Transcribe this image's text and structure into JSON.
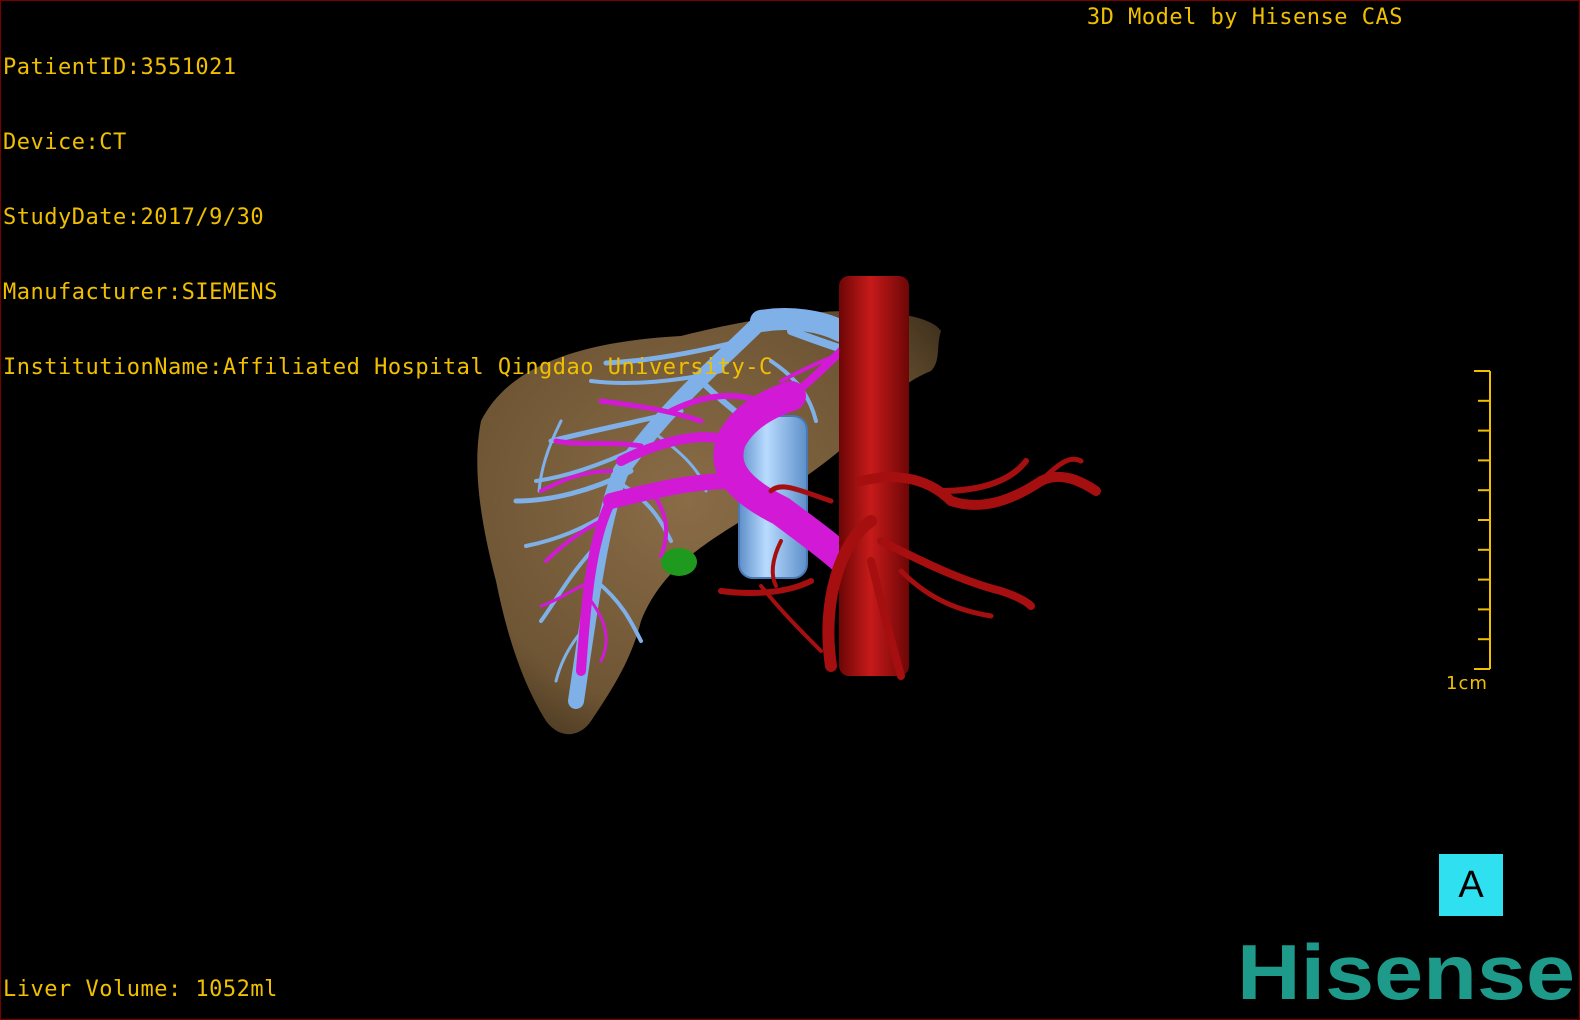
{
  "info": {
    "patient_id": "PatientID:3551021",
    "device": "Device:CT",
    "study_date": "StudyDate:2017/9/30",
    "manufacturer": "Manufacturer:SIEMENS",
    "institution": "InstitutionName:Affiliated Hospital Qingdao University-C"
  },
  "credit": "3D Model by Hisense CAS",
  "volume": "Liver Volume: 1052ml",
  "scale": {
    "label": "1cm",
    "ticks": 10
  },
  "orientation": "A",
  "logo": "Hisense",
  "colors": {
    "overlay_text": "#f0c000",
    "liver": "#7a5f3e",
    "hepatic_vein": "#7fb0e8",
    "portal_vein": "#d21ad6",
    "artery": "#a50f0f",
    "gallbladder": "#1f9a1f",
    "orientation_box": "#2fe0f0",
    "logo": "#1e9a8a"
  }
}
